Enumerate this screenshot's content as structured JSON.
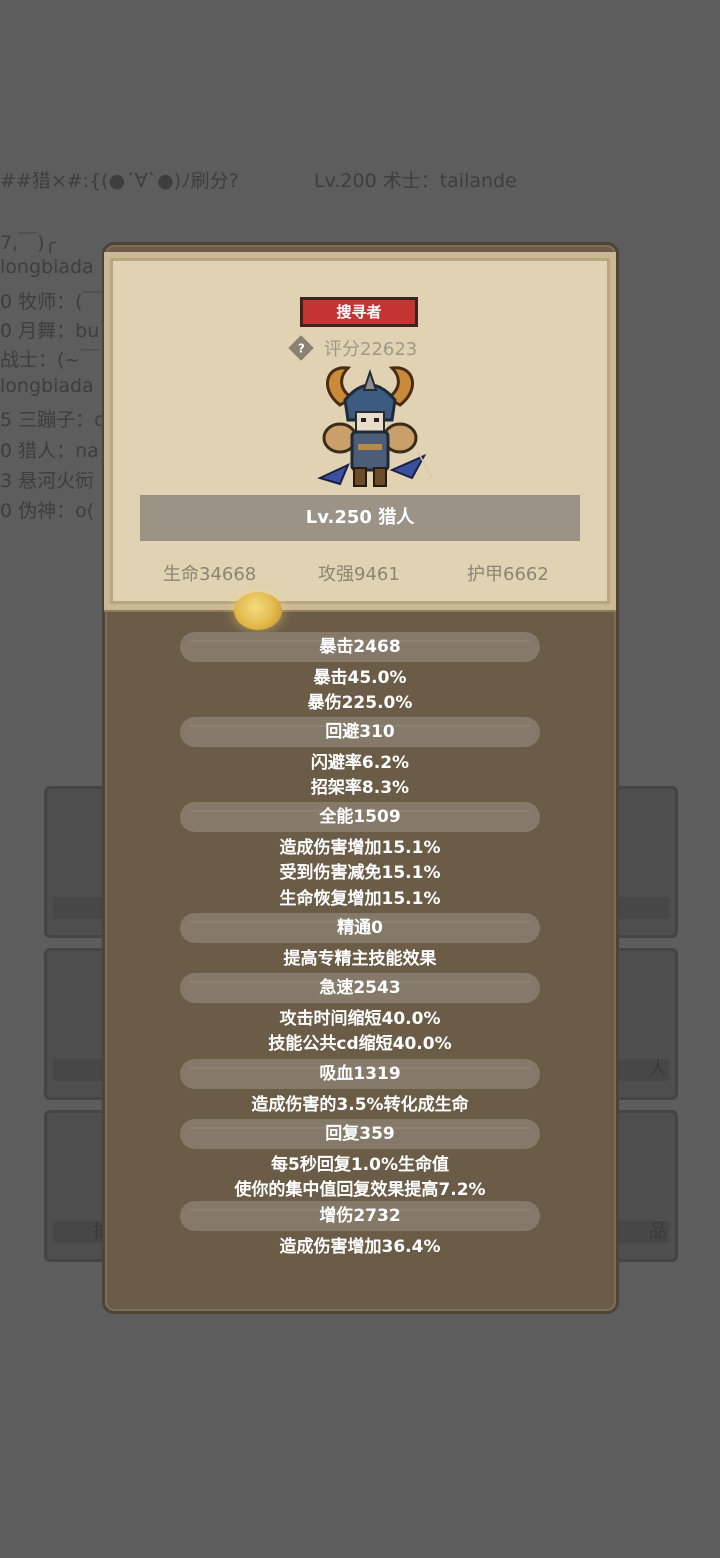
{
  "background": {
    "ranking_lines": [
      "##猎×#:{(●´∀`●)ﾉ刷分?",
      "Lv.200 术士：tailande",
      "7,￣)╭",
      "longbiada",
      "0 牧师：(￣",
      "0 月舞：bu",
      "战士：(~￣",
      "longbiada",
      "5 三蹦子：c",
      "0 猎人：na",
      "3 悬河火衏",
      "0 伪神：o("
    ],
    "card_labels": [
      "人",
      "品",
      "拍"
    ]
  },
  "character": {
    "class_badge": "搜寻者",
    "score": "评分22623",
    "level_class": "Lv.250 猎人",
    "core_stats": {
      "hp": "生命34668",
      "attack": "攻强9461",
      "armor": "护甲6662"
    }
  },
  "stats": [
    {
      "name": "暴击2468",
      "details": [
        "暴击45.0%",
        "暴伤225.0%"
      ]
    },
    {
      "name": "回避310",
      "details": [
        "闪避率6.2%",
        "招架率8.3%"
      ]
    },
    {
      "name": "全能1509",
      "details": [
        "造成伤害增加15.1%",
        "受到伤害减免15.1%",
        "生命恢复增加15.1%"
      ]
    },
    {
      "name": "精通0",
      "details": [
        "提高专精主技能效果"
      ]
    },
    {
      "name": "急速2543",
      "details": [
        "攻击时间缩短40.0%",
        "技能公共cd缩短40.0%"
      ]
    },
    {
      "name": "吸血1319",
      "details": [
        "造成伤害的3.5%转化成生命"
      ]
    },
    {
      "name": "回复359",
      "details": [
        "每5秒回复1.0%生命值",
        "使你的集中值回复效果提高7.2%"
      ]
    },
    {
      "name": "增伤2732",
      "details": [
        "造成伤害增加36.4%"
      ]
    }
  ],
  "colors": {
    "badge": "#c63333",
    "panel": "#6b5c47",
    "header_card": "#e0d2b3"
  }
}
